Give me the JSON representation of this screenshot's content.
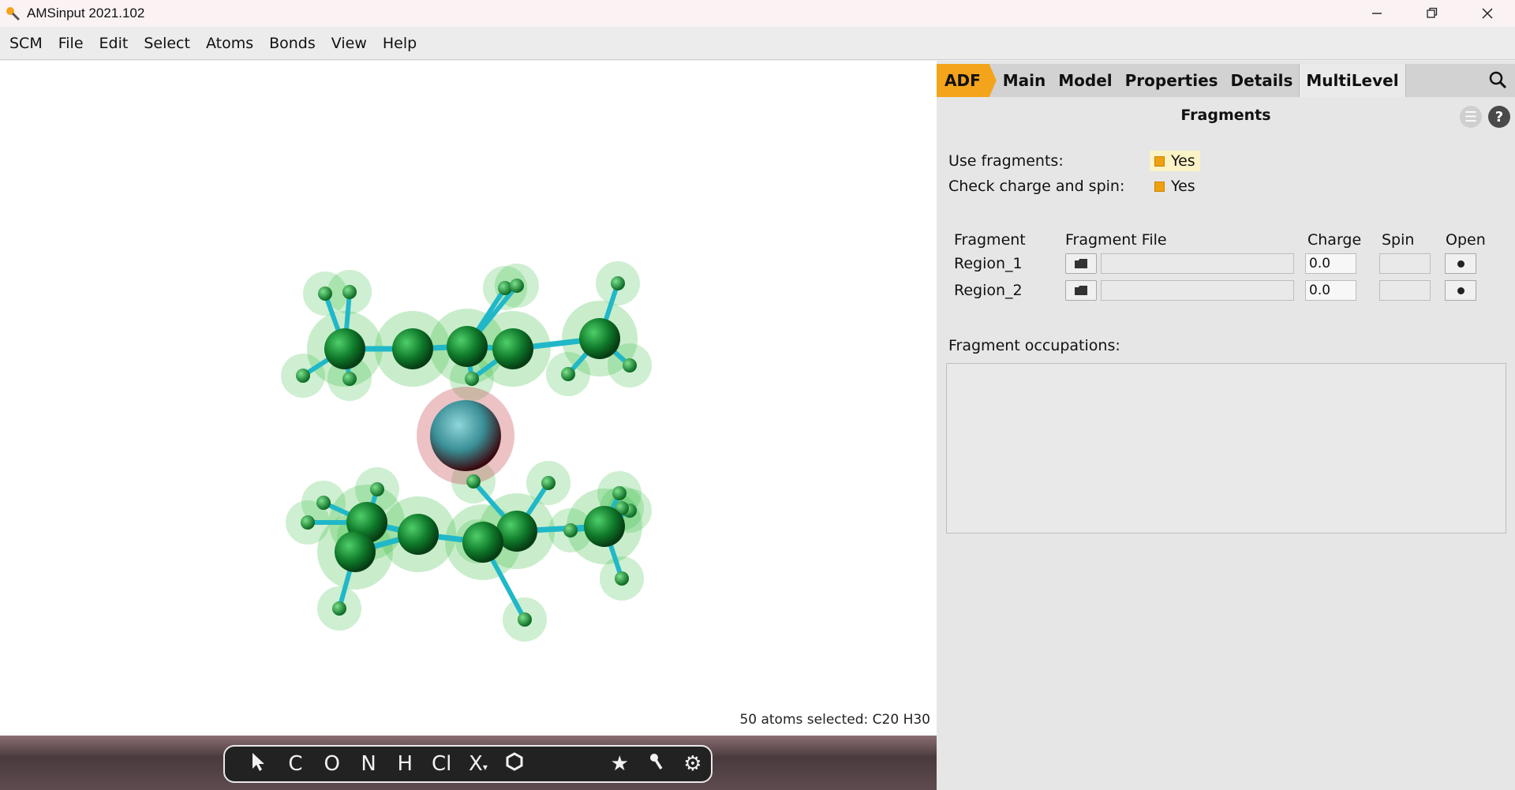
{
  "window": {
    "title": "AMSinput 2021.102",
    "controls": [
      "minimize-icon",
      "restore-icon",
      "close-icon"
    ]
  },
  "menu": {
    "items": [
      "SCM",
      "File",
      "Edit",
      "Select",
      "Atoms",
      "Bonds",
      "View",
      "Help"
    ]
  },
  "viewer": {
    "status": "50 atoms selected: C20 H30"
  },
  "toolbar": {
    "tools": [
      "pointer-icon",
      "C",
      "O",
      "N",
      "H",
      "Cl",
      "X",
      "ring-icon",
      "star-icon",
      "wrench-icon",
      "gear-icon"
    ],
    "labels": {
      "c": "C",
      "o": "O",
      "n": "N",
      "h": "H",
      "cl": "Cl",
      "x": "X"
    }
  },
  "panel": {
    "tabs": [
      "ADF",
      "Main",
      "Model",
      "Properties",
      "Details",
      "MultiLevel"
    ],
    "active_tab": "MultiLevel",
    "title": "Fragments",
    "use_fragments_label": "Use fragments:",
    "use_fragments_value": "Yes",
    "check_charge_label": "Check charge and spin:",
    "check_charge_value": "Yes",
    "columns": {
      "fragment": "Fragment",
      "file": "Fragment File",
      "charge": "Charge",
      "spin": "Spin",
      "open": "Open"
    },
    "fragments": [
      {
        "name": "Region_1",
        "file": "",
        "charge": "0.0",
        "spin": ""
      },
      {
        "name": "Region_2",
        "file": "",
        "charge": "0.0",
        "spin": ""
      }
    ],
    "occupations_label": "Fragment occupations:",
    "occupations_value": ""
  },
  "colors": {
    "adf_tab": "#f4a41a",
    "checkbox": "#f0a00e",
    "carbon": "#0f7a2a",
    "hydrogen": "#1aa03a",
    "bond": "#20b8c8",
    "metal": "#3a8f96"
  }
}
